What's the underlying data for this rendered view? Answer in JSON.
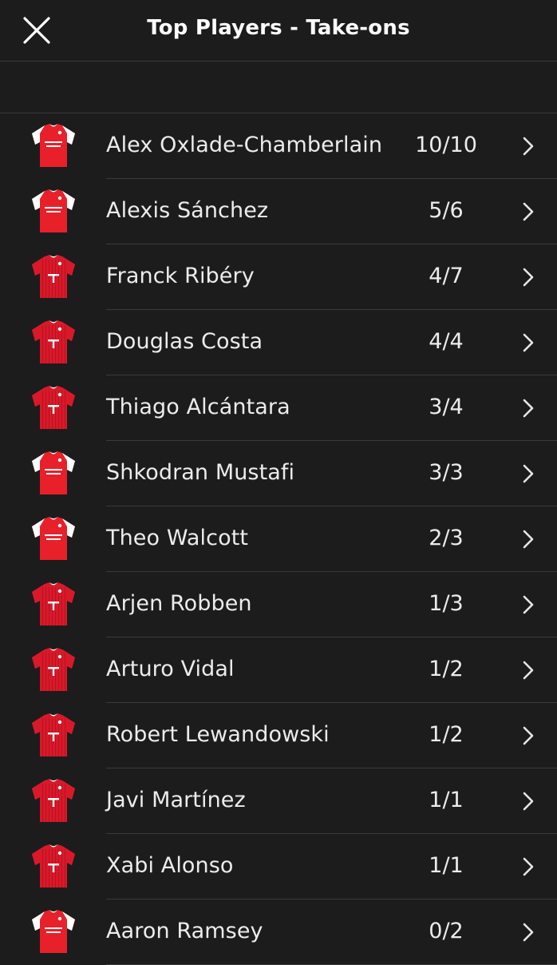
{
  "header": {
    "title": "Top Players - Take-ons",
    "close_icon": "close-icon"
  },
  "colors": {
    "background": "#1c1c1c",
    "divider": "#3a3a3a",
    "text": "#ececec",
    "jersey_red": "#e8202a",
    "jersey_white": "#ffffff"
  },
  "players": [
    {
      "name": "Alex Oxlade-Chamberlain",
      "stat": "10/10",
      "team": "arsenal"
    },
    {
      "name": "Alexis Sánchez",
      "stat": "5/6",
      "team": "arsenal"
    },
    {
      "name": "Franck Ribéry",
      "stat": "4/7",
      "team": "bayern"
    },
    {
      "name": "Douglas Costa",
      "stat": "4/4",
      "team": "bayern"
    },
    {
      "name": "Thiago Alcántara",
      "stat": "3/4",
      "team": "bayern"
    },
    {
      "name": "Shkodran Mustafi",
      "stat": "3/3",
      "team": "arsenal"
    },
    {
      "name": "Theo Walcott",
      "stat": "2/3",
      "team": "arsenal"
    },
    {
      "name": "Arjen Robben",
      "stat": "1/3",
      "team": "bayern"
    },
    {
      "name": "Arturo Vidal",
      "stat": "1/2",
      "team": "bayern"
    },
    {
      "name": "Robert Lewandowski",
      "stat": "1/2",
      "team": "bayern"
    },
    {
      "name": "Javi Martínez",
      "stat": "1/1",
      "team": "bayern"
    },
    {
      "name": "Xabi Alonso",
      "stat": "1/1",
      "team": "bayern"
    },
    {
      "name": "Aaron Ramsey",
      "stat": "0/2",
      "team": "arsenal"
    }
  ],
  "row_chevron_icon": "chevron-right-icon"
}
